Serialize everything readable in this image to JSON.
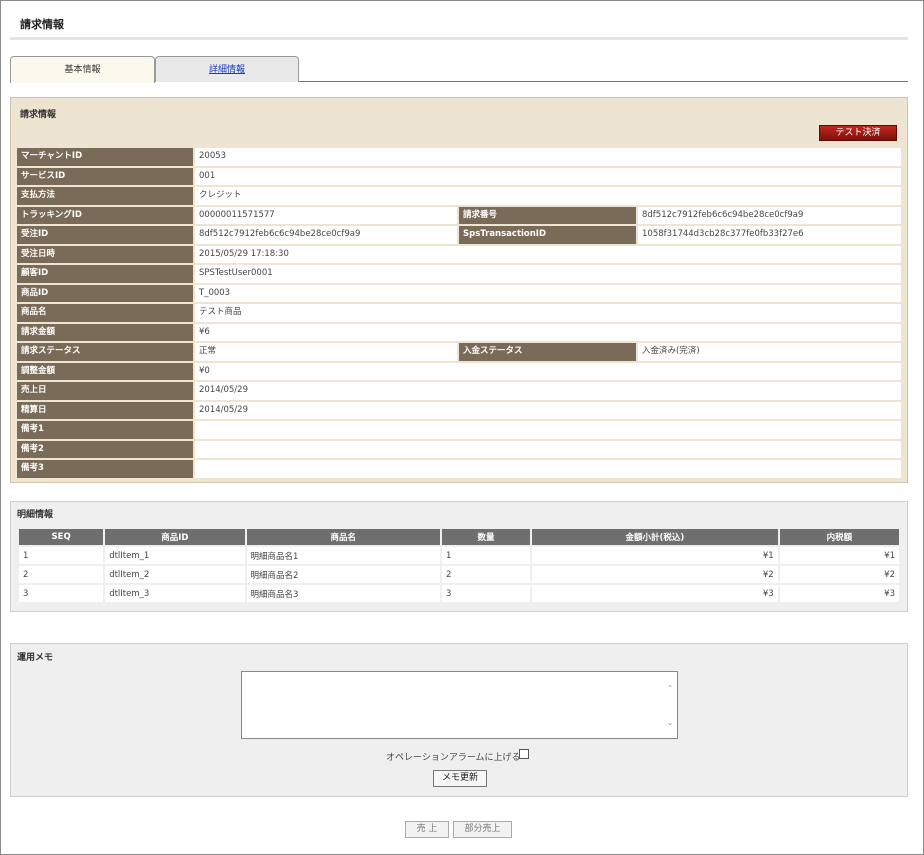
{
  "header": {
    "title": "請求情報"
  },
  "tabs": [
    {
      "label": "基本情報",
      "active": true
    },
    {
      "label": "詳細情報",
      "active": false
    }
  ],
  "billing": {
    "title": "請求情報",
    "test_button": "テスト決済",
    "fields": [
      {
        "label": "マーチャントID",
        "value": "20053"
      },
      {
        "label": "サービスID",
        "value": "001"
      },
      {
        "label": "支払方法",
        "value": "クレジット"
      },
      {
        "label": "トラッキングID",
        "value": "00000011571577",
        "label2": "請求番号",
        "value2": "8df512c7912feb6c6c94be28ce0cf9a9"
      },
      {
        "label": "受注ID",
        "value": "8df512c7912feb6c6c94be28ce0cf9a9",
        "label2": "SpsTransactionID",
        "value2": "1058f31744d3cb28c377fe0fb33f27e6"
      },
      {
        "label": "受注日時",
        "value": "2015/05/29 17:18:30"
      },
      {
        "label": "顧客ID",
        "value": "SPSTestUser0001"
      },
      {
        "label": "商品ID",
        "value": "T_0003"
      },
      {
        "label": "商品名",
        "value": "テスト商品"
      },
      {
        "label": "請求金額",
        "value": "¥6"
      },
      {
        "label": "請求ステータス",
        "value": "正常",
        "label2": "入金ステータス",
        "value2": "入金済み(完済)"
      },
      {
        "label": "調整金額",
        "value": "¥0"
      },
      {
        "label": "売上日",
        "value": "2014/05/29"
      },
      {
        "label": "精算日",
        "value": "2014/05/29"
      },
      {
        "label": "備考1",
        "value": ""
      },
      {
        "label": "備考2",
        "value": ""
      },
      {
        "label": "備考3",
        "value": ""
      }
    ]
  },
  "detail": {
    "title": "明細情報",
    "columns": [
      "SEQ",
      "商品ID",
      "商品名",
      "数量",
      "金額小計(税込)",
      "内税額"
    ],
    "rows": [
      [
        "1",
        "dtlItem_1",
        "明細商品名1",
        "1",
        "¥1",
        "¥1"
      ],
      [
        "2",
        "dtlItem_2",
        "明細商品名2",
        "2",
        "¥2",
        "¥2"
      ],
      [
        "3",
        "dtlItem_3",
        "明細商品名3",
        "3",
        "¥3",
        "¥3"
      ]
    ]
  },
  "memo": {
    "title": "運用メモ",
    "text": "",
    "alarm_label": "オペレーションアラームに上げる",
    "update_button": "メモ更新"
  },
  "footer": {
    "sales_button": "売 上",
    "partial_sales_button": "部分売上"
  }
}
